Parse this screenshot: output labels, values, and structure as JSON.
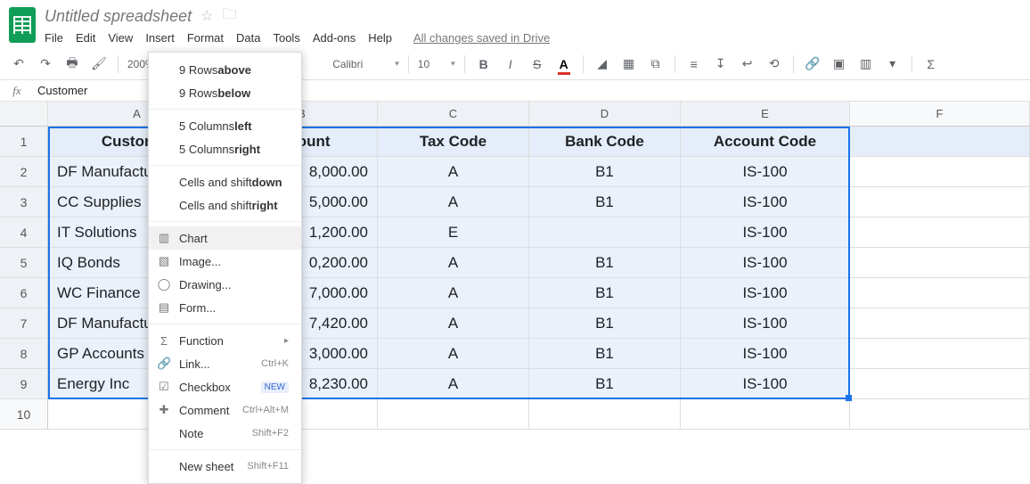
{
  "app": {
    "doc_title": "Untitled spreadsheet",
    "saved_msg": "All changes saved in Drive"
  },
  "menubar": [
    "File",
    "Edit",
    "View",
    "Insert",
    "Format",
    "Data",
    "Tools",
    "Add-ons",
    "Help"
  ],
  "toolbar": {
    "zoom": "200%",
    "font": "Calibri",
    "size": "10"
  },
  "formula_bar": {
    "fx": "fx",
    "value": "Customer"
  },
  "columns": [
    "A",
    "B",
    "C",
    "D",
    "E",
    "F"
  ],
  "row_numbers": [
    "1",
    "2",
    "3",
    "4",
    "5",
    "6",
    "7",
    "8",
    "9",
    "10"
  ],
  "header_row": [
    "Customer",
    "Amount",
    "Tax Code",
    "Bank Code",
    "Account Code"
  ],
  "data_rows": [
    {
      "customer": "DF Manufacturing",
      "amount": "8,000.00",
      "tax": "A",
      "bank": "B1",
      "acct": "IS-100"
    },
    {
      "customer": "CC Supplies",
      "amount": "5,000.00",
      "tax": "A",
      "bank": "B1",
      "acct": "IS-100"
    },
    {
      "customer": "IT Solutions",
      "amount": "1,200.00",
      "tax": "E",
      "bank": "",
      "acct": "IS-100"
    },
    {
      "customer": "IQ Bonds",
      "amount": "0,200.00",
      "tax": "A",
      "bank": "B1",
      "acct": "IS-100"
    },
    {
      "customer": "WC Finance",
      "amount": "7,000.00",
      "tax": "A",
      "bank": "B1",
      "acct": "IS-100"
    },
    {
      "customer": "DF Manufacturing",
      "amount": "7,420.00",
      "tax": "A",
      "bank": "B1",
      "acct": "IS-100"
    },
    {
      "customer": "GP Accounts",
      "amount": "3,000.00",
      "tax": "A",
      "bank": "B1",
      "acct": "IS-100"
    },
    {
      "customer": "Energy Inc",
      "amount": "8,230.00",
      "tax": "A",
      "bank": "B1",
      "acct": "IS-100"
    }
  ],
  "insert_menu": {
    "rows_above": {
      "pre": "9 Rows ",
      "bold": "above"
    },
    "rows_below": {
      "pre": "9 Rows ",
      "bold": "below"
    },
    "cols_left": {
      "pre": "5 Columns ",
      "bold": "left"
    },
    "cols_right": {
      "pre": "5 Columns ",
      "bold": "right"
    },
    "cells_down": {
      "pre": "Cells and shift ",
      "bold": "down"
    },
    "cells_right": {
      "pre": "Cells and shift ",
      "bold": "right"
    },
    "chart": "Chart",
    "image": "Image...",
    "drawing": "Drawing...",
    "form": "Form...",
    "function": "Function",
    "link": "Link...",
    "link_sc": "Ctrl+K",
    "checkbox": "Checkbox",
    "checkbox_badge": "NEW",
    "comment": "Comment",
    "comment_sc": "Ctrl+Alt+M",
    "note": "Note",
    "note_sc": "Shift+F2",
    "newsheet": "New sheet",
    "newsheet_sc": "Shift+F11"
  }
}
